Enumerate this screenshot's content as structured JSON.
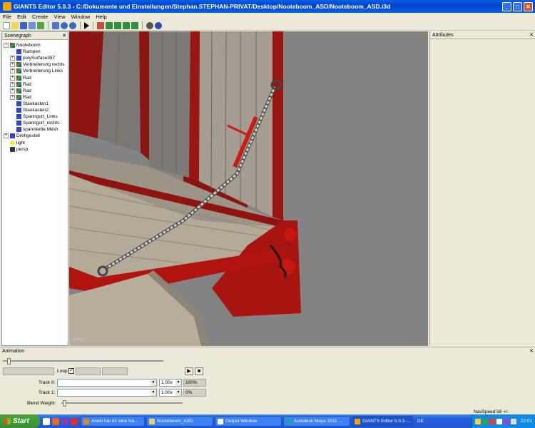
{
  "window": {
    "title": "GIANTS Editor 5.0.3 - C:/Dokumente und Einstellungen/Stephan.STEPHAN-PRIVAT/Desktop/Nooteboom_ASD/Nooteboom_ASD.i3d",
    "minimize": "_",
    "maximize": "□",
    "close": "✕"
  },
  "menu": [
    "File",
    "Edit",
    "Create",
    "View",
    "Window",
    "Help"
  ],
  "toolbar": {
    "icons": [
      "new-icon",
      "open-icon",
      "save-icon",
      "save-as-icon",
      "export-icon",
      "import-icon",
      "undo-icon",
      "redo-icon",
      "play-icon",
      "home-icon",
      "terrain-raise-icon",
      "terrain-lower-icon",
      "terrain-smooth-icon",
      "terrain-paint-icon",
      "select-icon",
      "move-icon"
    ]
  },
  "scenegraph": {
    "title": "Scenegraph",
    "close": "✕",
    "nodes": [
      {
        "label": "Nooteboom",
        "level": 0,
        "expander": "−",
        "icon": "transform"
      },
      {
        "label": "Rampen",
        "level": 1,
        "expander": "",
        "icon": "shape"
      },
      {
        "label": "polySurface357",
        "level": 1,
        "expander": "+",
        "icon": "shape"
      },
      {
        "label": "Verbreiterung rechts",
        "level": 1,
        "expander": "+",
        "icon": "transform"
      },
      {
        "label": "Verbreiterung Links",
        "level": 1,
        "expander": "+",
        "icon": "transform"
      },
      {
        "label": "Rad",
        "level": 1,
        "expander": "+",
        "icon": "transform"
      },
      {
        "label": "Rad",
        "level": 1,
        "expander": "+",
        "icon": "transform"
      },
      {
        "label": "Rad",
        "level": 1,
        "expander": "+",
        "icon": "transform"
      },
      {
        "label": "Rad",
        "level": 1,
        "expander": "+",
        "icon": "transform"
      },
      {
        "label": "Staukasten1",
        "level": 1,
        "expander": "",
        "icon": "shape"
      },
      {
        "label": "Staukasten2",
        "level": 1,
        "expander": "",
        "icon": "shape"
      },
      {
        "label": "Spanngurt_Links",
        "level": 1,
        "expander": "",
        "icon": "shape"
      },
      {
        "label": "Spanngurt_rechts",
        "level": 1,
        "expander": "",
        "icon": "shape"
      },
      {
        "label": "spannkette:Mesh",
        "level": 1,
        "expander": "",
        "icon": "shape"
      },
      {
        "label": "Drehgestell",
        "level": 0,
        "expander": "+",
        "icon": "shape"
      },
      {
        "label": "light",
        "level": 0,
        "expander": "",
        "icon": "light"
      },
      {
        "label": "persp",
        "level": 0,
        "expander": "",
        "icon": "camera"
      }
    ]
  },
  "viewport": {
    "camera": "persp"
  },
  "attributes": {
    "title": "Attributes",
    "close": "✕"
  },
  "animation": {
    "title": "Animation",
    "close": "✕",
    "loop_label": "Loop",
    "loop_checked": "✓",
    "play": "▶",
    "stop": "■",
    "track0": {
      "label": "Track 0:",
      "speed": "1.00x",
      "weight": "100%"
    },
    "track1": {
      "label": "Track 1:",
      "speed": "1.00x",
      "weight": "0%"
    },
    "blend_label": "Blend Weight:",
    "dropdown_arrow": "▼"
  },
  "status": {
    "navspeed": "NavSpeed 58 +/-"
  },
  "taskbar": {
    "start": "Start",
    "tasks": [
      {
        "label": "Arwin hat dir eine Na...",
        "icon_color": "#e08a1e"
      },
      {
        "label": "Nooteboom_ASD",
        "icon_color": "#f2d35c"
      },
      {
        "label": "Output Window",
        "icon_color": "#ffffff"
      },
      {
        "label": "Autodesk Maya 2011 ...",
        "icon_color": "#1c9fa8"
      },
      {
        "label": "GIANTS Editor 5.0.3 -...",
        "icon_color": "#f6a400"
      }
    ],
    "language": "DE",
    "clock": "22:01"
  },
  "colors": {
    "viewport_bg": "#838383",
    "trailer_red": "#b1140f",
    "deck_wood": "#b3aa98",
    "chain": "#c9c9c9",
    "xp_blue": "#245edb",
    "start_green": "#3c8f33"
  }
}
